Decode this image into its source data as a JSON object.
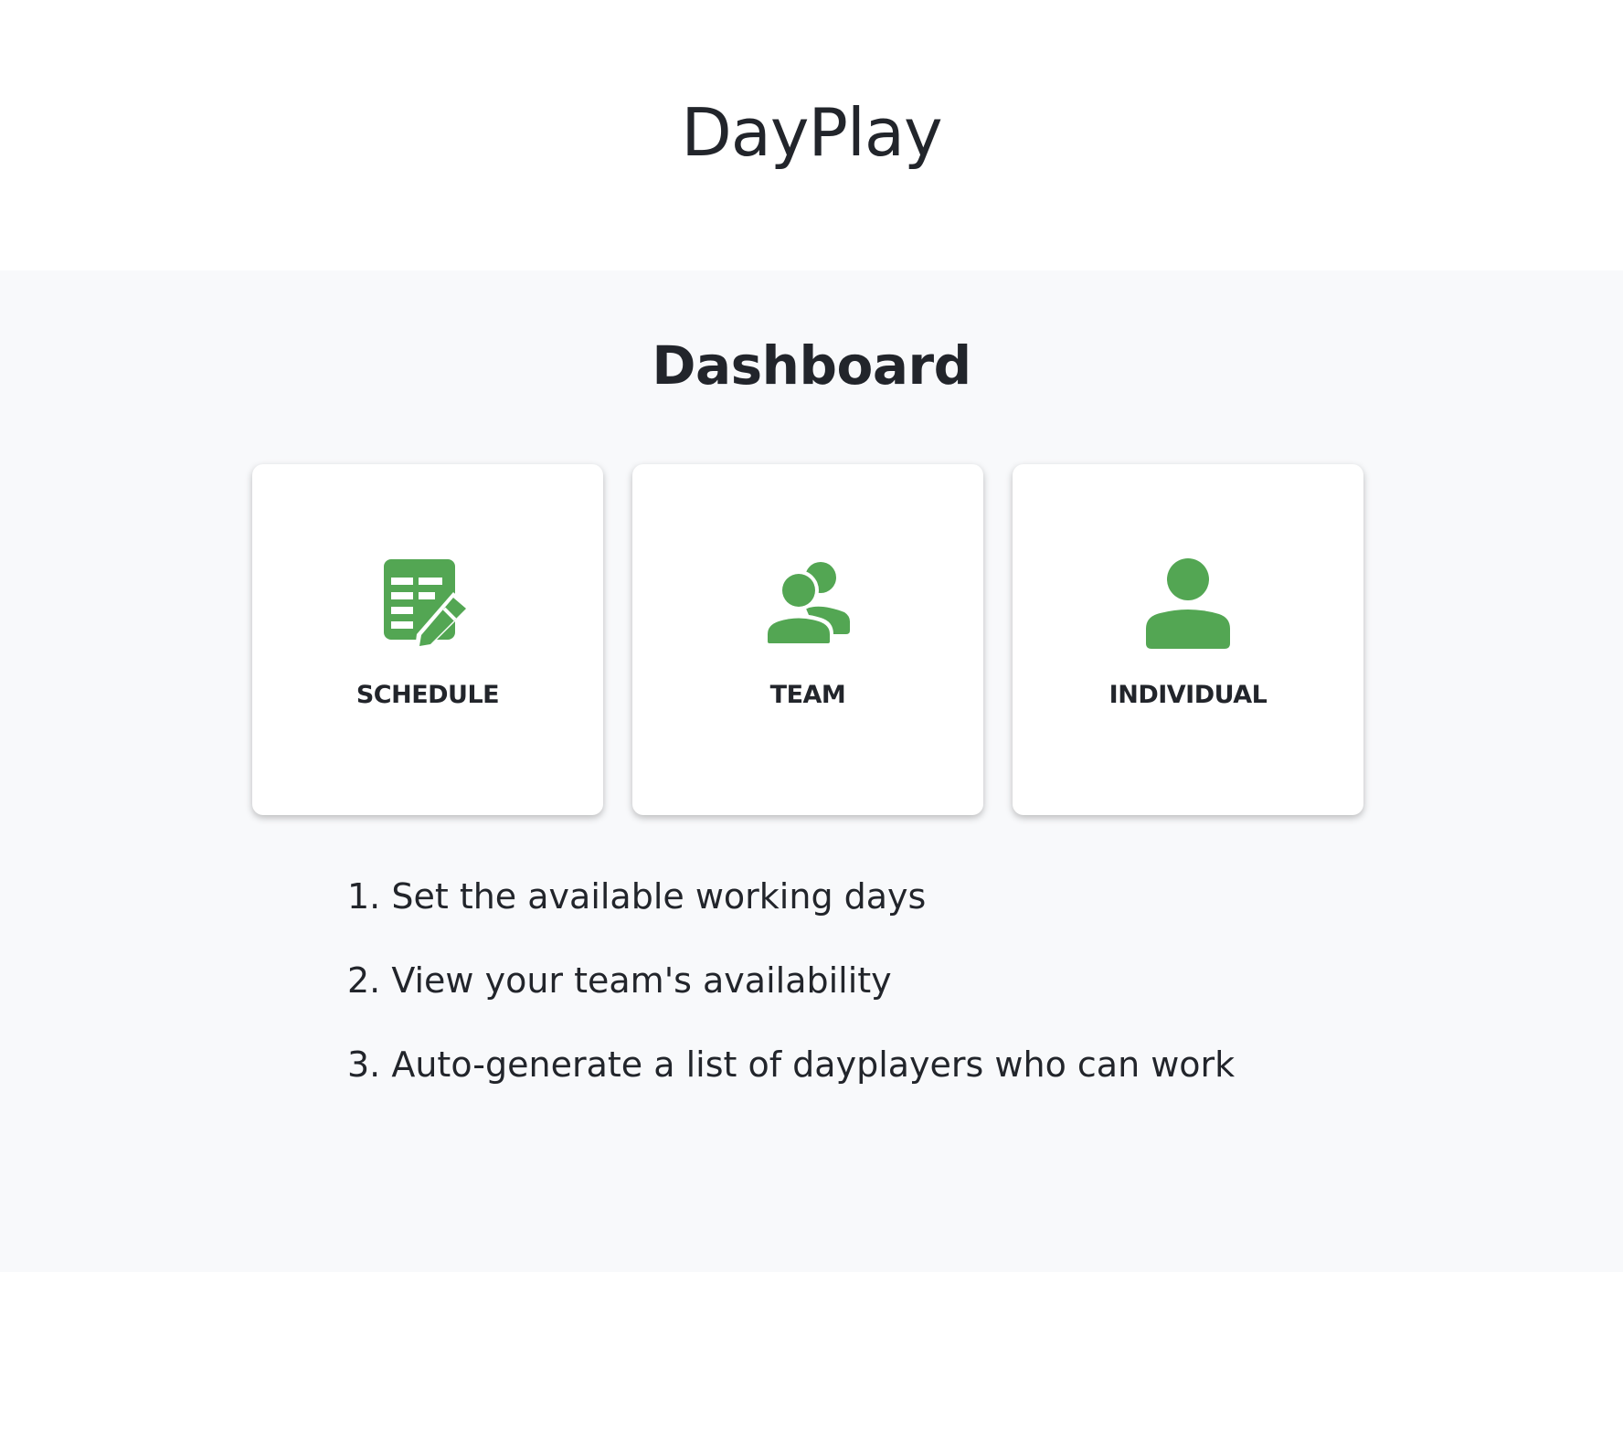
{
  "header": {
    "app_title": "DayPlay"
  },
  "main": {
    "page_title": "Dashboard",
    "cards": [
      {
        "label": "SCHEDULE",
        "icon": "schedule-edit-icon"
      },
      {
        "label": "TEAM",
        "icon": "team-icon"
      },
      {
        "label": "INDIVIDUAL",
        "icon": "person-icon"
      }
    ],
    "steps": [
      "1. Set the available working days",
      "2. View your team's availability",
      "3. Auto-generate a list of dayplayers who can work"
    ]
  },
  "colors": {
    "accent": "#53a653",
    "text": "#22252b",
    "section_background": "#f8f9fb"
  }
}
